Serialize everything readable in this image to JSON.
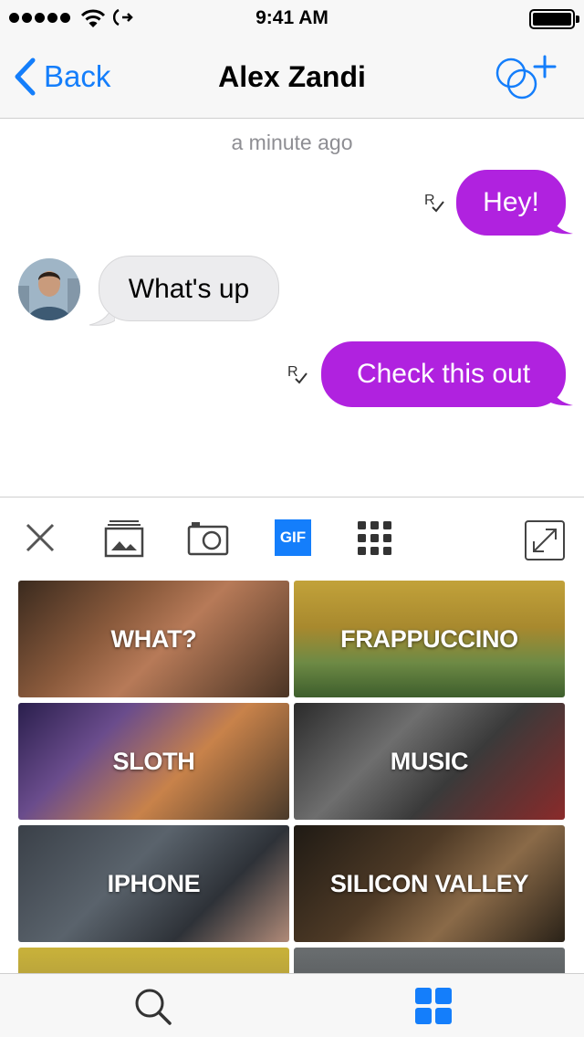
{
  "status_bar": {
    "time": "9:41 AM",
    "signal_dots": 5,
    "battery_level": 1.0
  },
  "nav": {
    "back_label": "Back",
    "title": "Alex Zandi",
    "add_icon": "add-participant-icon"
  },
  "chat": {
    "timestamp": "a minute ago",
    "messages": [
      {
        "direction": "outgoing",
        "text": "Hey!",
        "receipt": "R"
      },
      {
        "direction": "incoming",
        "text": "What's up"
      },
      {
        "direction": "outgoing",
        "text": "Check this out",
        "receipt": "R"
      }
    ]
  },
  "toolbar": {
    "items": [
      "close-icon",
      "photo-library-icon",
      "camera-icon",
      "gif-button",
      "apps-grid-icon",
      "expand-icon"
    ],
    "gif_label": "GIF",
    "accent": "#147efb"
  },
  "gif_grid": {
    "tiles": [
      {
        "label": "WHAT?"
      },
      {
        "label": "FRAPPUCCINO"
      },
      {
        "label": "SLOTH"
      },
      {
        "label": "MUSIC"
      },
      {
        "label": "IPHONE"
      },
      {
        "label": "SILICON VALLEY"
      }
    ]
  },
  "tab_bar": {
    "items": [
      "search-icon",
      "categories-grid-icon"
    ],
    "active": "categories-grid-icon"
  },
  "colors": {
    "outgoing_bubble": "#b022df",
    "incoming_bubble": "#ececee",
    "accent": "#147efb"
  }
}
